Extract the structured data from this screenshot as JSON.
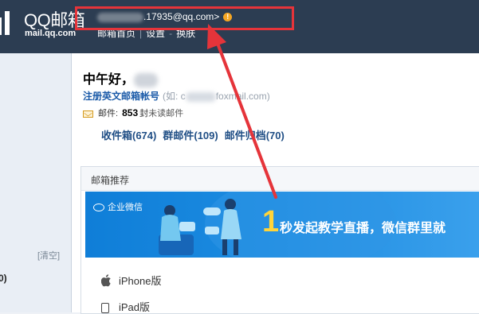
{
  "header": {
    "brand_name": "QQ邮箱",
    "brand_domain": "mail.qq.com",
    "account_suffix": ".17935@qq.com>",
    "links": [
      "邮箱首页",
      "设置",
      "换肤"
    ]
  },
  "greeting": {
    "text": "中午好，",
    "register_link": "注册英文邮箱帐号",
    "register_hint_prefix": "(如: c",
    "register_hint_suffix": "foxmail.com)"
  },
  "mail": {
    "label": "邮件:",
    "unread_count": "853",
    "unit": "封",
    "unread_link": "未读邮件"
  },
  "folders": [
    {
      "label": "收件箱(674)"
    },
    {
      "label": "群邮件(109)"
    },
    {
      "label": "邮件归档(70)"
    }
  ],
  "sidebar": {
    "clear_label": "[清空]",
    "count_fragment": "0)"
  },
  "recommend": {
    "title": "邮箱推荐",
    "banner_brand": "企业微信",
    "banner_number": "1",
    "banner_text": "秒发起教学直播，微信群里就",
    "devices": [
      {
        "label": "iPhone版",
        "icon": "apple-icon"
      },
      {
        "label": "iPad版",
        "icon": "ipad-icon"
      }
    ]
  },
  "colors": {
    "topbar": "#2c3d52",
    "highlight": "#e5343a",
    "link": "#1f4e85",
    "banner": "#1c8be0",
    "banner_number": "#ffd43a"
  }
}
